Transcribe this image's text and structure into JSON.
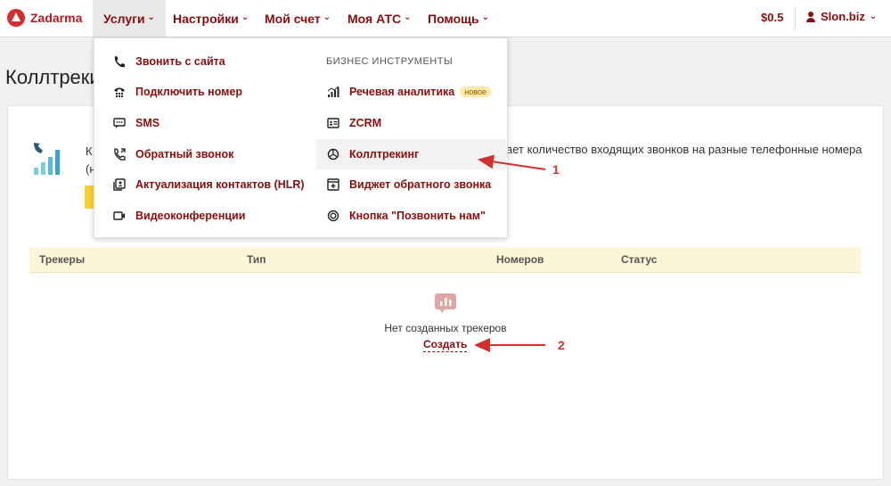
{
  "brand": {
    "name": "Zadarma"
  },
  "nav": {
    "items": [
      {
        "label": "Услуги"
      },
      {
        "label": "Настройки"
      },
      {
        "label": "Мой счет"
      },
      {
        "label": "Моя АТС"
      },
      {
        "label": "Помощь"
      }
    ],
    "balance": "$0.5",
    "account": "Slon.biz"
  },
  "page": {
    "title": "Коллтрекин",
    "desc_left_1": "К",
    "desc_left_2": "(н",
    "desc_right": "ает количество входящих звонков на разные телефонные номера"
  },
  "dropdown": {
    "left": [
      {
        "label": "Звонить с сайта",
        "icon": "phone-icon"
      },
      {
        "label": "Подключить номер",
        "icon": "switchboard-icon"
      },
      {
        "label": "SMS",
        "icon": "chat-icon"
      },
      {
        "label": "Обратный звонок",
        "icon": "callback-icon"
      },
      {
        "label": "Актуализация контактов (HLR)",
        "icon": "contacts-icon"
      },
      {
        "label": "Видеоконференции",
        "icon": "video-icon"
      }
    ],
    "section_title": "БИЗНЕС ИНСТРУМЕНТЫ",
    "right": [
      {
        "label": "Речевая аналитика",
        "icon": "analytics-icon",
        "badge": "новое"
      },
      {
        "label": "ZCRM",
        "icon": "crm-icon"
      },
      {
        "label": "Коллтрекинг",
        "icon": "pie-icon"
      },
      {
        "label": "Виджет обратного звонка",
        "icon": "widget-icon"
      },
      {
        "label": "Кнопка \"Позвонить нам\"",
        "icon": "button-icon"
      }
    ]
  },
  "table": {
    "headers": [
      "Трекеры",
      "Тип",
      "Номеров",
      "Статус"
    ],
    "empty_text": "Нет созданных трекеров",
    "create_label": "Создать"
  },
  "annotations": {
    "one": "1",
    "two": "2"
  },
  "colors": {
    "brand": "#8b0d0d",
    "accent": "#d32f2f",
    "table_head": "#fdf5d8",
    "yellow": "#fad02c"
  }
}
